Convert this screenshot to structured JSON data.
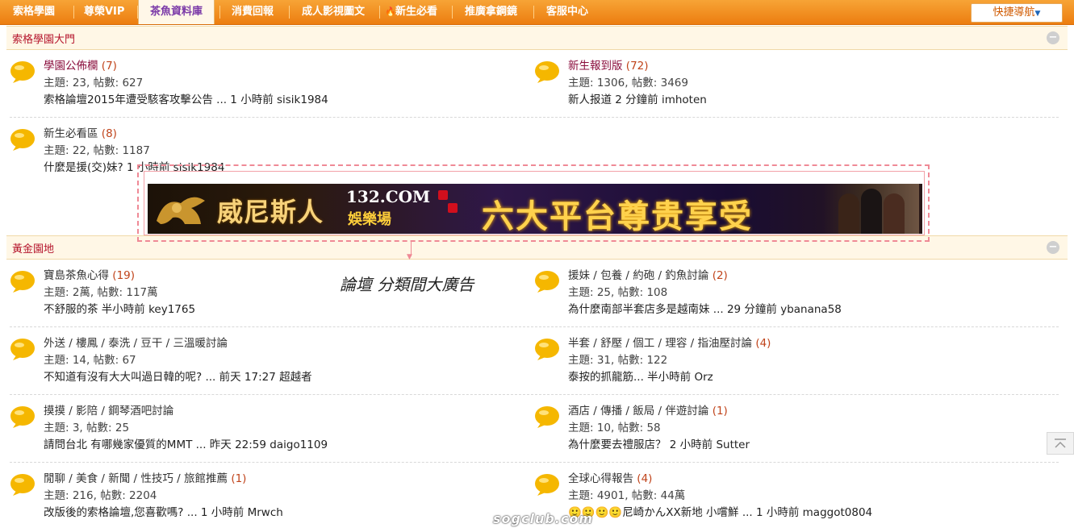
{
  "nav": {
    "items": [
      "索格學園",
      "尊榮VIP",
      "茶魚資料庫",
      "消費回報",
      "成人影視圖文",
      "新生必看",
      "推廣拿鋼鏡",
      "客服中心"
    ],
    "quick_nav_label": "快捷導航",
    "fire_icon": "fire-icon"
  },
  "sections": [
    {
      "title": "索格學園大門",
      "collapse_label": "−"
    },
    {
      "title": "黃金園地",
      "collapse_label": "−"
    }
  ],
  "boards": [
    {
      "name": "學園公佈欄",
      "count": "(7)",
      "stats": "主題: 23, 帖數: 627",
      "latest": "索格論壇2015年遭受駭客攻擊公告 ... 1 小時前 sisik1984"
    },
    {
      "name": "新生報到版",
      "count": "(72)",
      "stats": "主題: 1306, 帖數: 3469",
      "latest": "新人报道 2 分鐘前 imhoten"
    },
    {
      "name": "新生必看區",
      "count": "(8)",
      "stats": "主題: 22, 帖數: 1187",
      "latest": "什麼是援(交)妹? 1 小時前 sisik1984"
    },
    {
      "name": "寶島茶魚心得",
      "count": "(19)",
      "stats": "主題: 2萬, 帖數: 117萬",
      "latest": "不舒服的茶 半小時前 key1765"
    },
    {
      "name": "援妹 / 包養 / 約砲 / 釣魚討論",
      "count": "(2)",
      "stats": "主題: 25, 帖數: 108",
      "latest": "為什麼南部半套店多是越南妹 ... 29 分鐘前 ybanana58"
    },
    {
      "name": "外送 / 樓鳳 / 泰洗 / 豆干 / 三溫暖討論",
      "count": "",
      "stats": "主題: 14, 帖數: 67",
      "latest": "不知道有沒有大大叫過日韓的呢? ... 前天 17:27 超越者"
    },
    {
      "name": "半套 / 舒壓 / 個工 / 理容 / 指油壓討論",
      "count": "(4)",
      "stats": "主題: 31, 帖數: 122",
      "latest": "泰按的抓龍筋... 半小時前 Orz"
    },
    {
      "name": "摸摸 / 影陪 / 鋼琴酒吧討論",
      "count": "",
      "stats": "主題: 3, 帖數: 25",
      "latest": "請問台北 有哪幾家優質的MMT ... 昨天 22:59 daigo1109"
    },
    {
      "name": "酒店 / 傳播 / 飯局 / 伴遊討論",
      "count": "(1)",
      "stats": "主題: 10, 帖數: 58",
      "latest": "為什麼要去禮服店？ 2 小時前 Sutter"
    },
    {
      "name": "閒聊 / 美食 / 新聞 / 性技巧 / 旅館推薦",
      "count": "(1)",
      "stats": "主題: 216, 帖數: 2204",
      "latest": "改版後的索格論壇,您喜歡嗎? ... 1 小時前 Mrwch"
    },
    {
      "name": "全球心得報告",
      "count": "(4)",
      "stats": "主題: 4901, 帖數: 44萬",
      "latest": "🙂🙂🙂🙂尼崎かんXX新地 小嚐鮮 ... 1 小時前 maggot0804"
    }
  ],
  "ad": {
    "brand": "威尼斯人",
    "domain": "132.COM",
    "casino": "娛樂場",
    "slogan": "六大平台尊贵享受"
  },
  "caption": "論壇 分類間大廣告",
  "watermark": "sogclub.com",
  "colors": {
    "nav_orange": "#ec7d10",
    "section_title": "#b5162d",
    "board_name": "#8a0d3c",
    "count": "#c0441b",
    "ad_border": "#ef8a96"
  }
}
